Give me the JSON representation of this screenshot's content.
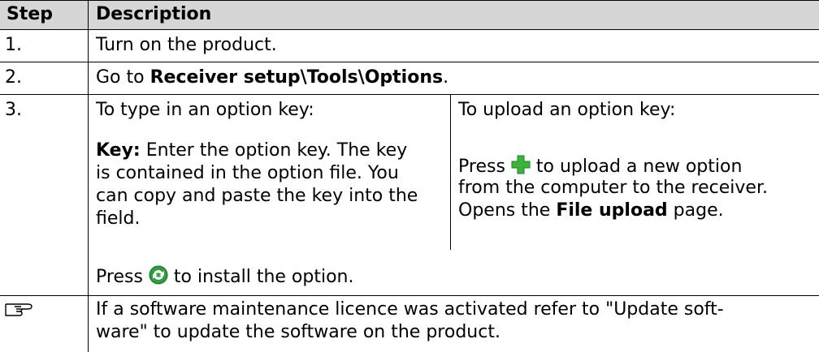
{
  "table": {
    "header": {
      "step": "Step",
      "description": "Description"
    },
    "row1": {
      "step": "1.",
      "text": "Turn on the product."
    },
    "row2": {
      "step": "2.",
      "prefix": "Go to ",
      "path": "Receiver setup\\Tools\\Options",
      "suffix": "."
    },
    "row3": {
      "step": "3.",
      "left": {
        "title": "To type in an option key:",
        "key_label": "Key:",
        "lines": [
          " Enter the option key. The key",
          "is contained in the option file. You",
          "can copy and paste the key into the",
          "field."
        ]
      },
      "right": {
        "title": "To upload an option key:",
        "line1_pre": "Press",
        "line1_post": "to upload a new option",
        "line2": "from the computer to the receiver.",
        "line3_pre": "Opens the ",
        "line3_bold": "File upload",
        "line3_post": " page."
      },
      "install_pre": "Press",
      "install_post": "to install the option."
    },
    "note": {
      "icon": "pointing-hand-icon",
      "line1": "If a software maintenance licence was activated refer to \"Update soft-",
      "line2": "ware\" to update the software on the product."
    }
  },
  "colors": {
    "header_bg": "#d6d6d6",
    "plus_icon": "#3cb43c",
    "install_icon": "#2e9e3a"
  }
}
